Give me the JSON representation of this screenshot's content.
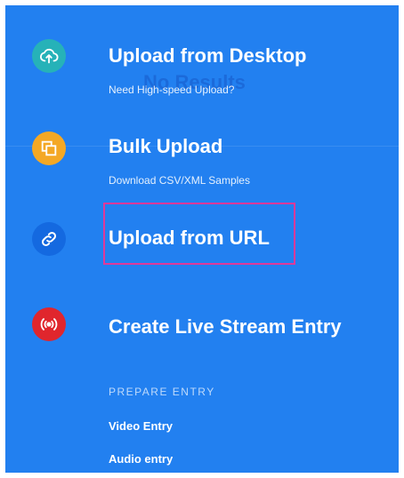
{
  "ghost_text": "No Results",
  "items": [
    {
      "title": "Upload from Desktop",
      "subtitle": "Need High-speed Upload?",
      "icon": "cloud-upload-icon",
      "icon_color": "#26b2b8"
    },
    {
      "title": "Bulk Upload",
      "subtitle": "Download CSV/XML Samples",
      "icon": "copy-stack-icon",
      "icon_color": "#f4a825"
    },
    {
      "title": "Upload from URL",
      "icon": "link-icon",
      "icon_color": "#1469e0"
    },
    {
      "title": "Create Live Stream Entry",
      "icon": "live-stream-icon",
      "icon_color": "#e0262d"
    }
  ],
  "prepare": {
    "heading": "PREPARE ENTRY",
    "links": [
      "Video Entry",
      "Audio entry"
    ]
  },
  "colors": {
    "panel_bg": "#2280f0",
    "highlight_border": "#e0399a"
  }
}
